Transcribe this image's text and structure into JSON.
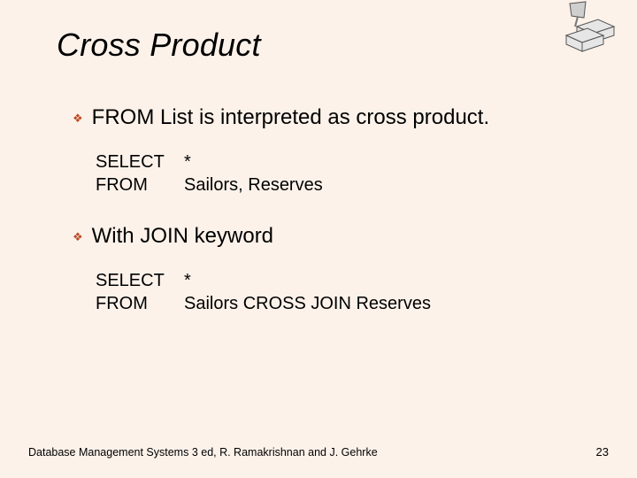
{
  "title": "Cross Product",
  "bullets": [
    {
      "text": "FROM List is interpreted as cross product."
    },
    {
      "text": "With JOIN keyword"
    }
  ],
  "code_blocks": [
    {
      "lines": [
        {
          "kw": "SELECT",
          "rest": "*"
        },
        {
          "kw": "FROM",
          "rest": "Sailors, Reserves"
        }
      ]
    },
    {
      "lines": [
        {
          "kw": "SELECT",
          "rest": "*"
        },
        {
          "kw": "FROM",
          "rest": "Sailors CROSS JOIN Reserves"
        }
      ]
    }
  ],
  "footer": "Database Management Systems 3 ed,  R. Ramakrishnan and J. Gehrke",
  "page_number": "23",
  "icons": {
    "diamond_bullet": "❖"
  }
}
